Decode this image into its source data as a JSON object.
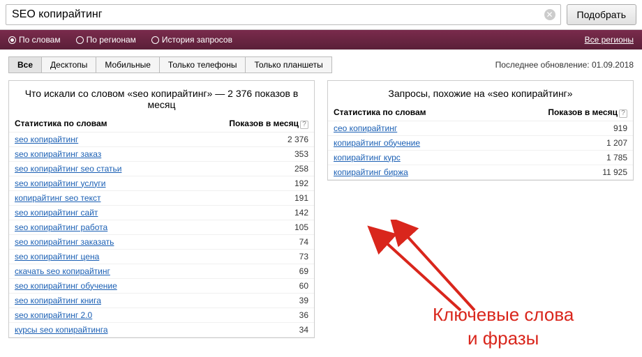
{
  "search": {
    "value": "SEO копирайтинг",
    "submit": "Подобрать"
  },
  "filters": {
    "radios": [
      {
        "label": "По словам",
        "selected": true
      },
      {
        "label": "По регионам",
        "selected": false
      },
      {
        "label": "История запросов",
        "selected": false
      }
    ],
    "region": "Все регионы"
  },
  "tabs": {
    "items": [
      "Все",
      "Десктопы",
      "Мобильные",
      "Только телефоны",
      "Только планшеты"
    ],
    "active": 0
  },
  "update": "Последнее обновление: 01.09.2018",
  "left": {
    "title": "Что искали со словом «seo копирайтинг» — 2 376 показов в месяц",
    "col1": "Статистика по словам",
    "col2": "Показов в месяц",
    "rows": [
      {
        "q": "seo копирайтинг",
        "n": "2 376"
      },
      {
        "q": "seo копирайтинг заказ",
        "n": "353"
      },
      {
        "q": "seo копирайтинг seo статьи",
        "n": "258"
      },
      {
        "q": "seo копирайтинг услуги",
        "n": "192"
      },
      {
        "q": "копирайтинг seo текст",
        "n": "191"
      },
      {
        "q": "seo копирайтинг сайт",
        "n": "142"
      },
      {
        "q": "seo копирайтинг работа",
        "n": "105"
      },
      {
        "q": "seo копирайтинг заказать",
        "n": "74"
      },
      {
        "q": "seo копирайтинг цена",
        "n": "73"
      },
      {
        "q": "скачать seo копирайтинг",
        "n": "69"
      },
      {
        "q": "seo копирайтинг обучение",
        "n": "60"
      },
      {
        "q": "seo копирайтинг книга",
        "n": "39"
      },
      {
        "q": "seo копирайтинг 2.0",
        "n": "36"
      },
      {
        "q": "курсы seo копирайтинга",
        "n": "34"
      }
    ]
  },
  "right": {
    "title": "Запросы, похожие на «seo копирайтинг»",
    "col1": "Статистика по словам",
    "col2": "Показов в месяц",
    "rows": [
      {
        "q": "сео копирайтинг",
        "n": "919"
      },
      {
        "q": "копирайтинг обучение",
        "n": "1 207"
      },
      {
        "q": "копирайтинг курс",
        "n": "1 785"
      },
      {
        "q": "копирайтинг биржа",
        "n": "11 925"
      }
    ]
  },
  "annotation": {
    "line1": "Ключевые слова",
    "line2": "и фразы"
  }
}
